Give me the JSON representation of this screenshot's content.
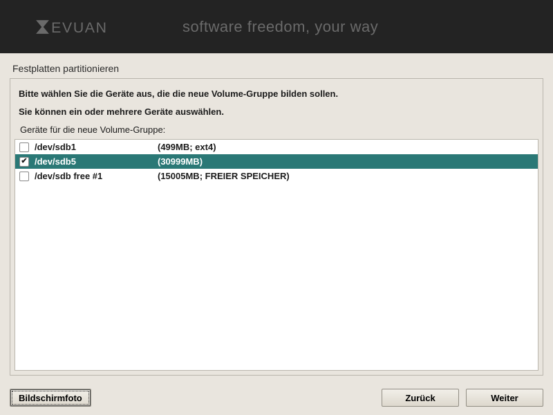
{
  "header": {
    "logo_text": "DEVUAN",
    "tagline": "software freedom, your way"
  },
  "page": {
    "title": "Festplatten partitionieren",
    "instruction_line1": "Bitte wählen Sie die Geräte aus, die die neue Volume-Gruppe bilden sollen.",
    "instruction_line2": "Sie können ein oder mehrere Geräte auswählen.",
    "prompt": "Geräte für die neue Volume-Gruppe:"
  },
  "devices": [
    {
      "name": "/dev/sdb1",
      "info": "(499MB; ext4)",
      "checked": false,
      "selected": false
    },
    {
      "name": "/dev/sdb5",
      "info": "(30999MB)",
      "checked": true,
      "selected": true
    },
    {
      "name": "/dev/sdb free #1",
      "info": "(15005MB; FREIER SPEICHER)",
      "checked": false,
      "selected": false
    }
  ],
  "buttons": {
    "screenshot": "Bildschirmfoto",
    "back": "Zurück",
    "continue": "Weiter"
  }
}
